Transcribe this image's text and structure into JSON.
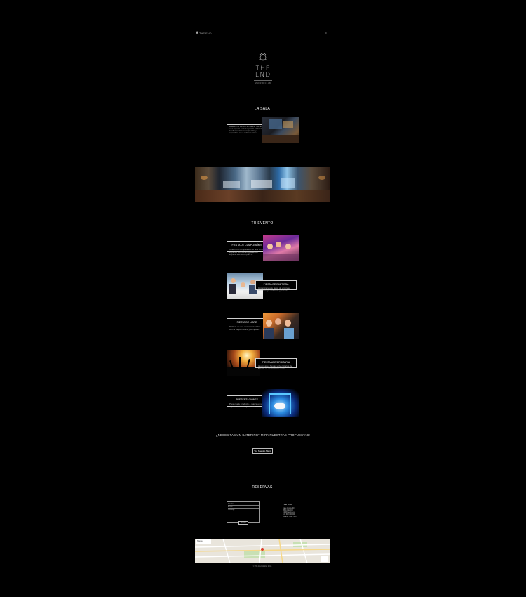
{
  "header": {
    "brand": "THE END",
    "menu_label": "≡"
  },
  "logo": {
    "line1": "THE",
    "line2": "END",
    "tagline": "MADRID CLUB"
  },
  "sala": {
    "heading": "LA SALA",
    "description": "Situada en el corazón de Madrid, THE END es un espacio exclusivo para la celebración de todo tipo de eventos privados y corporativos en un ambiente único."
  },
  "eventos": {
    "heading": "TU EVENTO",
    "cards": [
      {
        "title": "FIESTA DE CUMPLEAÑOS",
        "text": "Celebra tu cumpleaños de una forma especial con tus amigos en un espacio exclusivo para ti."
      },
      {
        "title": "FIESTA DE EMPRESA",
        "text": "Organizamos tu fiesta de empresa con el mejor ambiente y servicio."
      },
      {
        "title": "FIESTA DE LIBRE",
        "text": "Disfruta de una noche inolvidable con la mejor música y compañía."
      },
      {
        "title": "FIESTA UNIVERSITARIA",
        "text": "Las mejores fiestas universitarias de Madrid en un ambiente único."
      },
      {
        "title": "PRESENTACIONES",
        "text": "Presenta tu producto o marca en un espacio moderno y versátil."
      }
    ]
  },
  "catering": {
    "question": "¿NECESITAS UN CATERING? MIRA NUESTRAS PROPUESTAS!",
    "button": "Ver Nuestro Menú"
  },
  "reservas": {
    "heading": "RESERVAS",
    "form": {
      "name_placeholder": "Nombre",
      "email_placeholder": "Email",
      "message_placeholder": "Mensaje",
      "submit": "Enviar"
    },
    "contact": {
      "title": "THE END",
      "lines": [
        "Calle Alcalá, 00",
        "28014 Madrid",
        "info@theend.es",
        "+34 600 000 000",
        "Horario: Jue - Sáb"
      ]
    }
  },
  "map": {
    "label": "Mapa"
  },
  "footer": {
    "copyright": "© The End Madrid 2016"
  },
  "colors": {
    "background": "#000000",
    "text": "#dddddd",
    "border": "#cfcfcf"
  }
}
